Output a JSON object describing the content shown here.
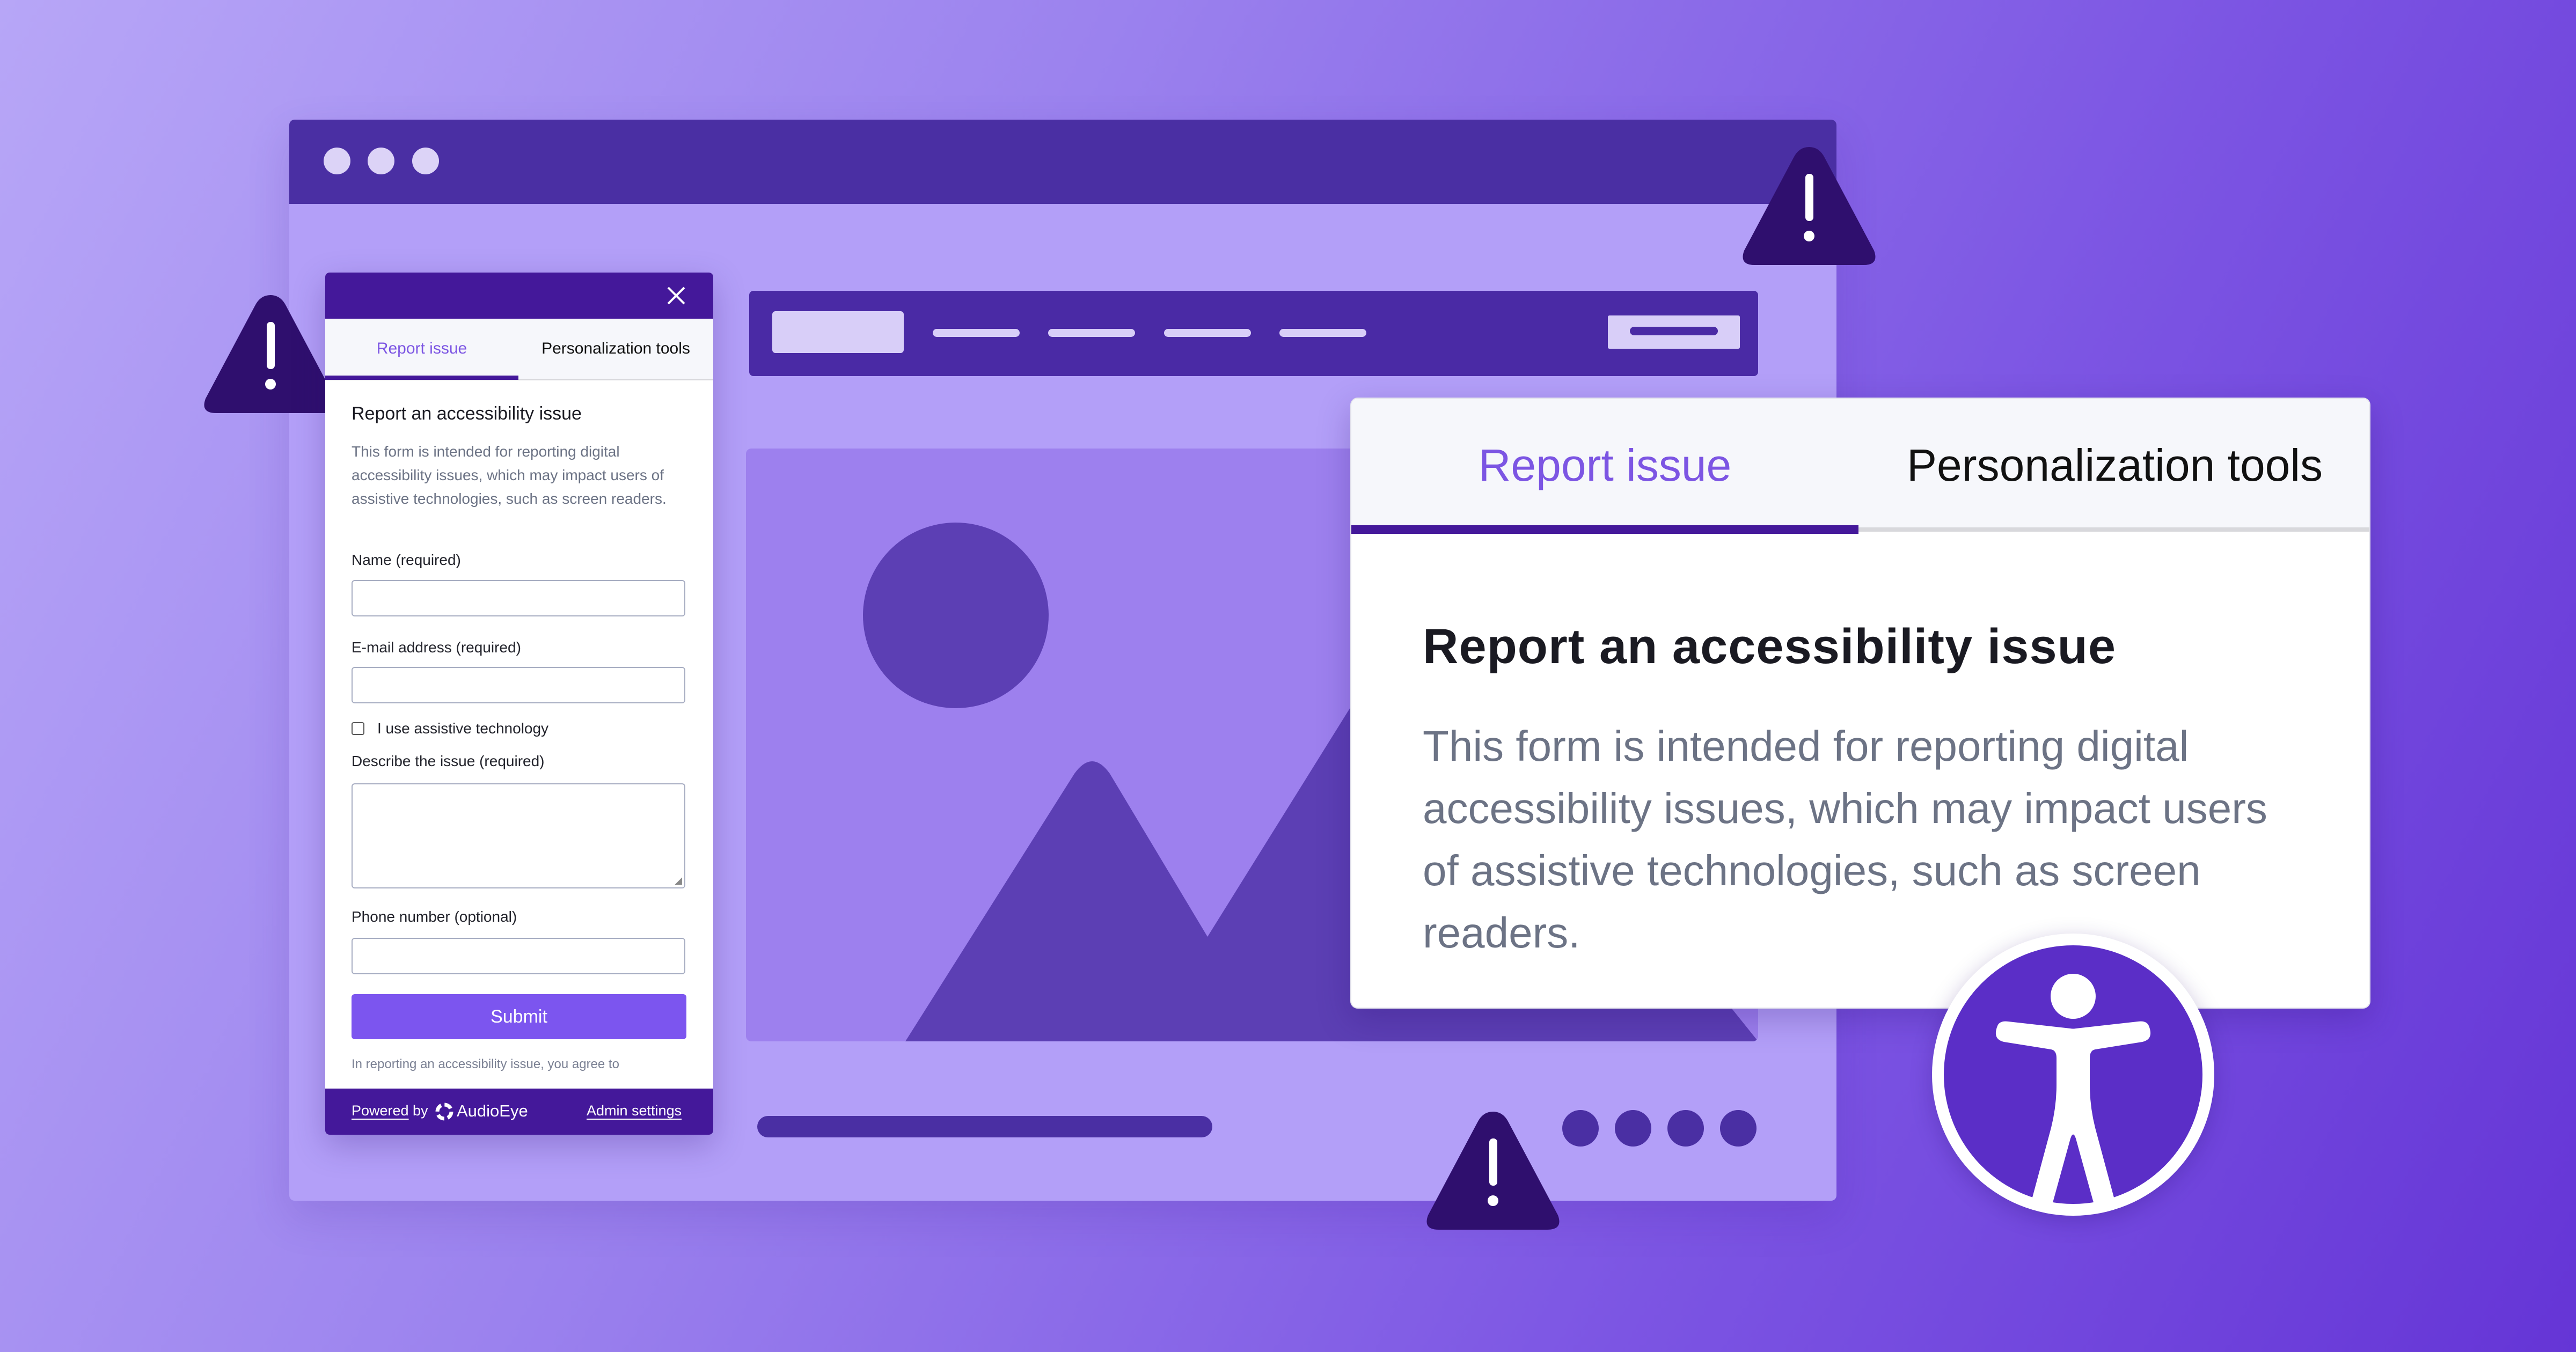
{
  "colors": {
    "brand_dark": "#44189a",
    "accent": "#7c55e3",
    "button": "#7c55ef",
    "warning_fill": "#2f0f6e"
  },
  "widget": {
    "close_icon": "close-icon",
    "tabs": [
      {
        "label": "Report issue",
        "active": true
      },
      {
        "label": "Personalization tools",
        "active": false
      }
    ],
    "title": "Report an accessibility issue",
    "description": "This form is intended for reporting digital accessibility issues, which may impact users of assistive technologies, such as screen readers.",
    "fields": {
      "name_label": "Name (required)",
      "name_value": "",
      "email_label": "E-mail address (required)",
      "email_value": "",
      "assistive_label": "I use assistive technology",
      "assistive_checked": false,
      "issue_label": "Describe the issue (required)",
      "issue_value": "",
      "phone_label": "Phone number (optional)",
      "phone_value": ""
    },
    "submit_label": "Submit",
    "agree_text": "In reporting an accessibility issue, you agree to",
    "footer": {
      "powered_label": "Powered",
      "by_label": "by",
      "brand_name": "AudioEye",
      "admin_label": "Admin settings"
    }
  },
  "card": {
    "tabs": [
      {
        "label": "Report issue",
        "active": true
      },
      {
        "label": "Personalization tools",
        "active": false
      }
    ],
    "title": "Report an accessibility issue",
    "description": "This form is intended for reporting digital accessibility issues, which may impact users of assistive technologies, such as screen readers."
  },
  "icons": {
    "accessibility": "accessibility-icon",
    "warning": "warning-icon"
  },
  "pagination": {
    "dot_count": 4
  }
}
